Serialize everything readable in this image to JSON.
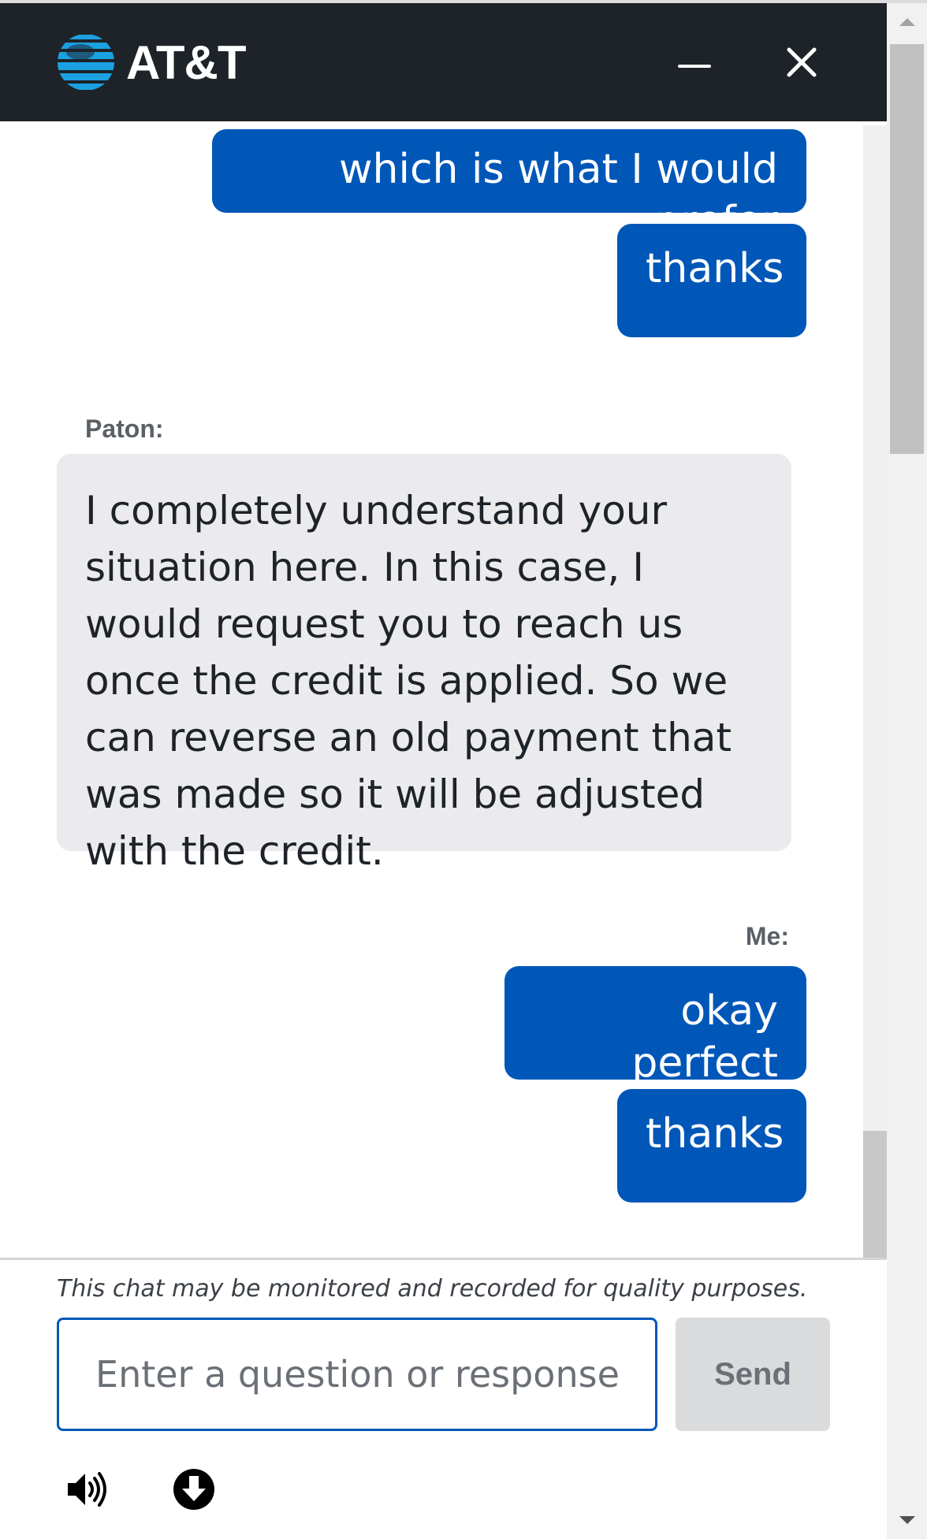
{
  "header": {
    "brand": "AT&T",
    "icons": {
      "logo": "att-globe-icon",
      "minimize": "minimize-icon",
      "close": "close-icon"
    }
  },
  "messages": [
    {
      "sender": "me",
      "text": "which is what I would prefer"
    },
    {
      "sender": "me",
      "text": "thanks"
    },
    {
      "sender_label": "Paton:",
      "sender": "agent",
      "text": "I completely understand your situation here. In this case, I would request you to reach us once the credit is applied. So we can reverse an old payment that was made so it will be adjusted with the credit."
    },
    {
      "sender_label": "Me:",
      "sender": "me",
      "text": "okay perfect"
    },
    {
      "sender": "me",
      "text": "thanks"
    }
  ],
  "footer": {
    "disclaimer": "This chat may be monitored and recorded for quality purposes.",
    "input_placeholder": "Enter a question or response",
    "input_value": "",
    "send_label": "Send",
    "icons": {
      "sound": "speaker-icon",
      "download": "download-icon"
    }
  },
  "colors": {
    "header_bg": "#1d2329",
    "user_bubble": "#0057b8",
    "agent_bubble": "#ebebed",
    "logo_blue": "#1ba1e2",
    "send_disabled": "#d9dbdd"
  }
}
